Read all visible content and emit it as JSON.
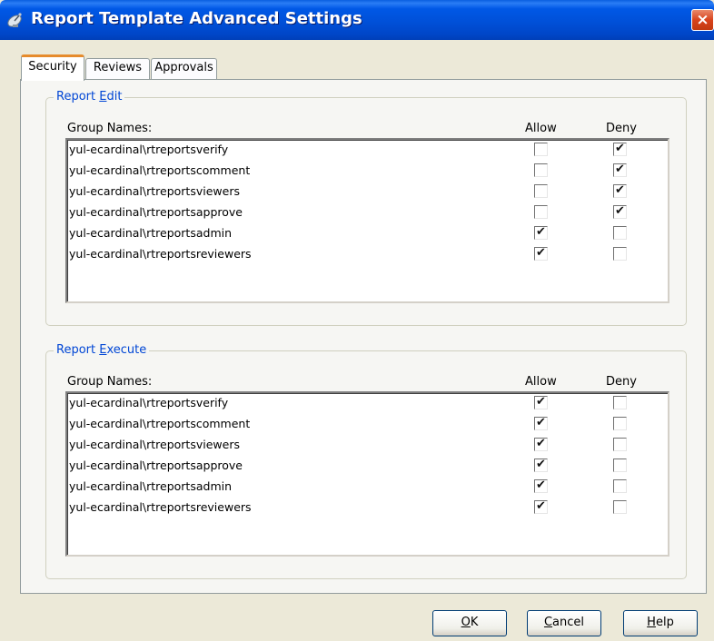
{
  "window": {
    "title": "Report Template Advanced Settings",
    "close_label": "×",
    "icon": "satellite-dish-icon"
  },
  "tabs": [
    {
      "label": "Security",
      "active": true
    },
    {
      "label": "Reviews",
      "active": false
    },
    {
      "label": "Approvals",
      "active": false
    }
  ],
  "report_edit": {
    "legend_prefix": "Report ",
    "legend_mnemonic": "E",
    "legend_suffix": "dit",
    "col_group": "Group Names:",
    "col_allow": "Allow",
    "col_deny": "Deny",
    "rows": [
      {
        "name": "yul-ecardinal\\rtreportsverify",
        "allow": false,
        "deny": true
      },
      {
        "name": "yul-ecardinal\\rtreportscomment",
        "allow": false,
        "deny": true
      },
      {
        "name": "yul-ecardinal\\rtreportsviewers",
        "allow": false,
        "deny": true
      },
      {
        "name": "yul-ecardinal\\rtreportsapprove",
        "allow": false,
        "deny": true
      },
      {
        "name": "yul-ecardinal\\rtreportsadmin",
        "allow": true,
        "deny": false
      },
      {
        "name": "yul-ecardinal\\rtreportsreviewers",
        "allow": true,
        "deny": false
      }
    ]
  },
  "report_execute": {
    "legend_prefix": "Report ",
    "legend_mnemonic": "E",
    "legend_suffix": "xecute",
    "col_group": "Group Names:",
    "col_allow": "Allow",
    "col_deny": "Deny",
    "rows": [
      {
        "name": "yul-ecardinal\\rtreportsverify",
        "allow": true,
        "deny": false
      },
      {
        "name": "yul-ecardinal\\rtreportscomment",
        "allow": true,
        "deny": false
      },
      {
        "name": "yul-ecardinal\\rtreportsviewers",
        "allow": true,
        "deny": false
      },
      {
        "name": "yul-ecardinal\\rtreportsapprove",
        "allow": true,
        "deny": false
      },
      {
        "name": "yul-ecardinal\\rtreportsadmin",
        "allow": true,
        "deny": false
      },
      {
        "name": "yul-ecardinal\\rtreportsreviewers",
        "allow": true,
        "deny": false
      }
    ]
  },
  "buttons": {
    "ok_mnemonic": "O",
    "ok_rest": "K",
    "cancel_mnemonic": "C",
    "cancel_rest": "ancel",
    "help_mnemonic": "H",
    "help_rest": "elp"
  },
  "colors": {
    "titlebar": "#0050d8",
    "legend_text": "#0046d5",
    "active_tab_accent": "#e68b2c",
    "close_button": "#d8431c"
  }
}
